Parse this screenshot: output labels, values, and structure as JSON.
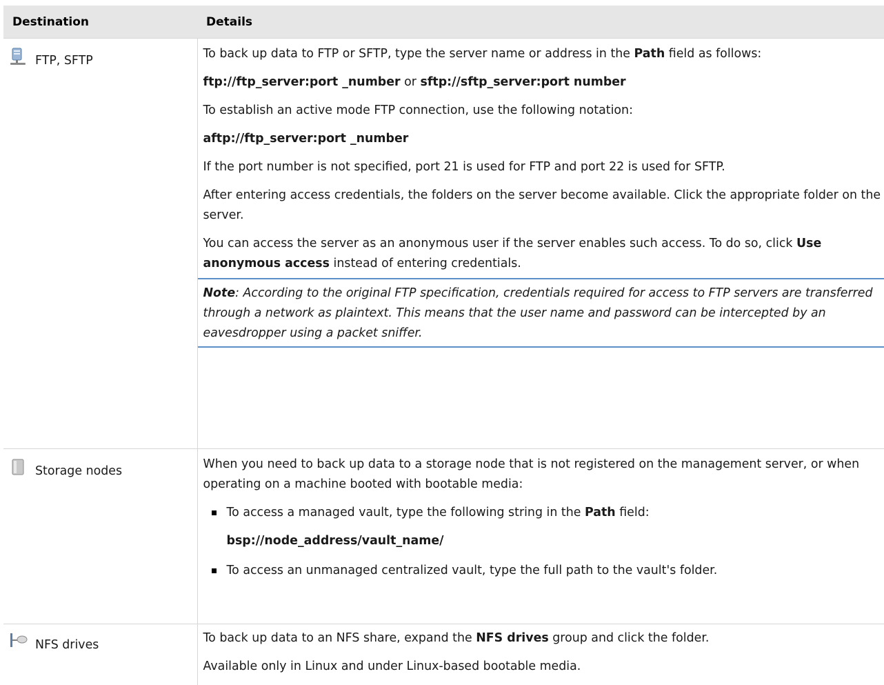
{
  "table": {
    "headers": [
      "Destination",
      "Details"
    ],
    "rows": [
      {
        "destination": "FTP, SFTP",
        "icon": "server-icon",
        "details": {
          "p1_pre": "To back up data to FTP or SFTP, type the server name or address in the ",
          "p1_bold": "Path",
          "p1_post": " field as follows:",
          "p2_bold1": "ftp://ftp_server:port _number",
          "p2_mid": " or ",
          "p2_bold2": "sftp://sftp_server:port number",
          "p3": "To establish an active mode FTP connection, use the following notation:",
          "p4_bold": "aftp://ftp_server:port _number",
          "p5": "If the port number is not specified, port 21 is used for FTP and port 22 is used for SFTP.",
          "p6": "After entering access credentials, the folders on the server become available. Click the appropriate folder on the server.",
          "p7_pre": "You can access the server as an anonymous user if the server enables such access. To do so, click ",
          "p7_bold": "Use anonymous access",
          "p7_post": " instead of entering credentials.",
          "note_label": "Note",
          "note_text": ": According to the original FTP specification, credentials required for access to FTP servers are transferred through a network as plaintext. This means that the user name and password can be intercepted by an eavesdropper using a packet sniffer."
        }
      },
      {
        "destination": "Storage nodes",
        "icon": "storage-node-icon",
        "details": {
          "p1": "When you need to back up data to a storage node that is not registered on the management server, or when operating on a machine booted with bootable media:",
          "b1_pre": "To access a managed vault, type the following string in the ",
          "b1_bold": "Path",
          "b1_post": " field:",
          "b1_code": "bsp://node_address/vault_name/",
          "b2": "To access an unmanaged centralized vault, type the full path to the vault's folder."
        }
      },
      {
        "destination": "NFS drives",
        "icon": "nfs-drive-icon",
        "details": {
          "p1_pre": "To back up data to an NFS share, expand the ",
          "p1_bold": "NFS drives",
          "p1_post": " group and click the folder.",
          "p2": "Available only in Linux and under Linux-based bootable media."
        }
      }
    ]
  },
  "colors": {
    "header_bg": "#e6e6e6",
    "note_rule": "#5b8fc6",
    "grid": "#d6d6d6"
  }
}
